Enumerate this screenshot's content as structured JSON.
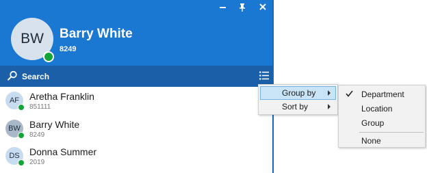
{
  "window": {
    "minimize_icon": "minimize-icon",
    "pin_icon": "pin-icon",
    "close_icon": "close-icon"
  },
  "user": {
    "initials": "BW",
    "name": "Barry White",
    "extension": "8249",
    "presence": "available"
  },
  "search": {
    "placeholder": "Search",
    "icon": "search-icon",
    "view_icon": "list-view-icon"
  },
  "contacts": [
    {
      "initials": "AF",
      "name": "Aretha Franklin",
      "extension": "851111",
      "avatar_color": "#c8dcef"
    },
    {
      "initials": "BW",
      "name": "Barry White",
      "extension": "8249",
      "avatar_color": "#a9b8c8"
    },
    {
      "initials": "DS",
      "name": "Donna Summer",
      "extension": "2019",
      "avatar_color": "#c8dcef"
    }
  ],
  "context_menu": {
    "items": [
      {
        "label": "Group by",
        "has_submenu": true,
        "highlighted": true
      },
      {
        "label": "Sort by",
        "has_submenu": true,
        "highlighted": false
      }
    ]
  },
  "group_by_menu": {
    "items": [
      {
        "label": "Department",
        "checked": true
      },
      {
        "label": "Location",
        "checked": false
      },
      {
        "label": "Group",
        "checked": false
      },
      {
        "label": "None",
        "checked": false
      }
    ]
  },
  "colors": {
    "header": "#1a78d2",
    "search_bar": "#1b5fa8",
    "presence_available": "#13a538",
    "menu_highlight": "#c9e3f7"
  }
}
